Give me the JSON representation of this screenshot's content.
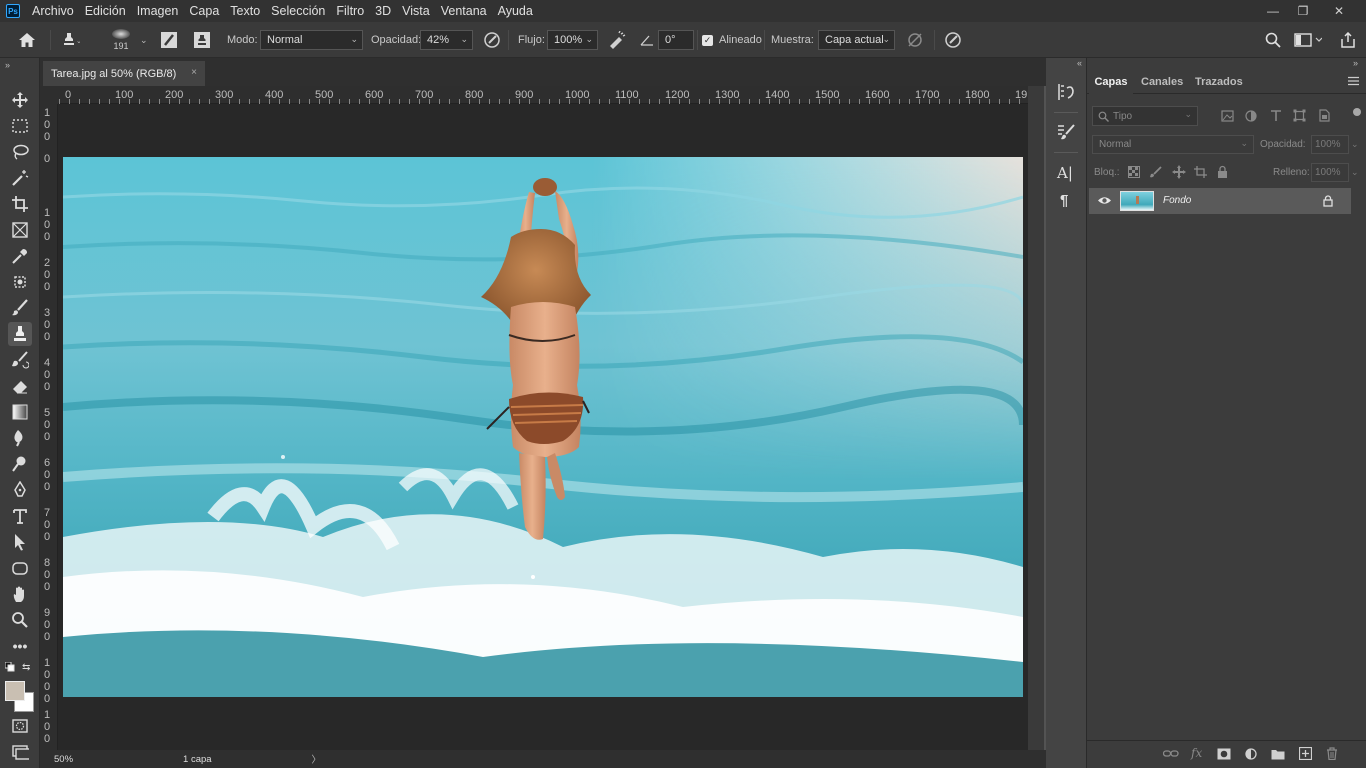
{
  "menubar": {
    "app_badge": "Ps",
    "items": [
      "Archivo",
      "Edición",
      "Imagen",
      "Capa",
      "Texto",
      "Selección",
      "Filtro",
      "3D",
      "Vista",
      "Ventana",
      "Ayuda"
    ],
    "window_controls": {
      "minimize": "—",
      "restore": "❐",
      "close": "✕"
    }
  },
  "options": {
    "brush_size": "191",
    "mode_label": "Modo:",
    "mode_value": "Normal",
    "opacity_label": "Opacidad:",
    "opacity_value": "42%",
    "flow_label": "Flujo:",
    "flow_value": "100%",
    "angle_value": "0°",
    "aligned_label": "Alineado",
    "aligned_checked": true,
    "sample_label": "Muestra:",
    "sample_value": "Capa actual"
  },
  "document": {
    "tab_title": "Tarea.jpg al 50% (RGB/8)",
    "close": "×",
    "zoom": "50%",
    "layers_info": "1 capa",
    "status_arrow": "〉"
  },
  "rulers": {
    "horizontal": [
      "0",
      "100",
      "200",
      "300",
      "400",
      "500",
      "600",
      "700",
      "800",
      "900",
      "1000",
      "1100",
      "1200",
      "1300",
      "1400",
      "1500",
      "1600",
      "1700",
      "1800",
      "19"
    ],
    "vertical": [
      "1",
      "0",
      "0",
      "0",
      "1",
      "0",
      "0",
      "2",
      "0",
      "0",
      "3",
      "0",
      "0",
      "4",
      "0",
      "0",
      "5",
      "0",
      "0",
      "6",
      "0",
      "0",
      "7",
      "0",
      "0",
      "8",
      "0",
      "0",
      "9",
      "0",
      "0",
      "1",
      "0",
      "0",
      "0",
      "1",
      "0",
      "0"
    ]
  },
  "side_strip": {
    "char_icon": "A|",
    "para_icon": "¶"
  },
  "layers_panel": {
    "tabs": [
      "Capas",
      "Canales",
      "Trazados"
    ],
    "active_tab": 0,
    "filter_placeholder": "Tipo",
    "blend_mode": "Normal",
    "opacity_label": "Opacidad:",
    "opacity_value": "100%",
    "lock_label": "Bloq.:",
    "fill_label": "Relleno:",
    "fill_value": "100%",
    "layers": [
      {
        "name": "Fondo",
        "visible": true,
        "locked": true
      }
    ]
  },
  "colors": {
    "foreground": "#c9bfb2",
    "background": "#ffffff",
    "accent": "#31a8ff"
  }
}
